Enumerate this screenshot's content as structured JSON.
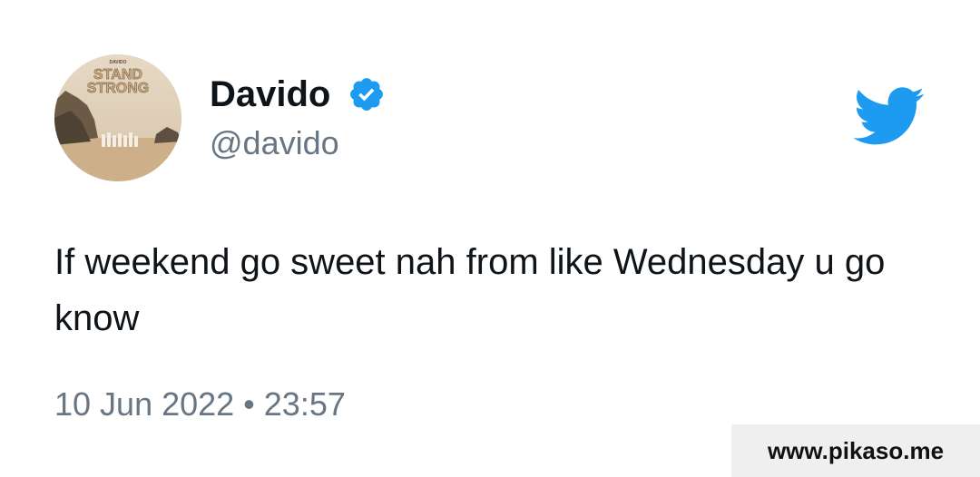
{
  "tweet": {
    "author": {
      "name": "Davido",
      "handle": "@davido",
      "verified": true,
      "avatar_text": {
        "small": "DAVIDO",
        "line1": "STAND",
        "line2": "STRONG"
      }
    },
    "text": "If weekend go sweet nah from like Wednesday u go know",
    "timestamp": "10 Jun 2022 • 23:57"
  },
  "watermark": "www.pikaso.me",
  "icons": {
    "verified": "verified-badge-icon",
    "brand": "twitter-bird-icon"
  },
  "colors": {
    "twitter_blue": "#1d9bf0",
    "text_primary": "#0f1419",
    "text_secondary": "#687684",
    "watermark_bg": "#efefef"
  }
}
